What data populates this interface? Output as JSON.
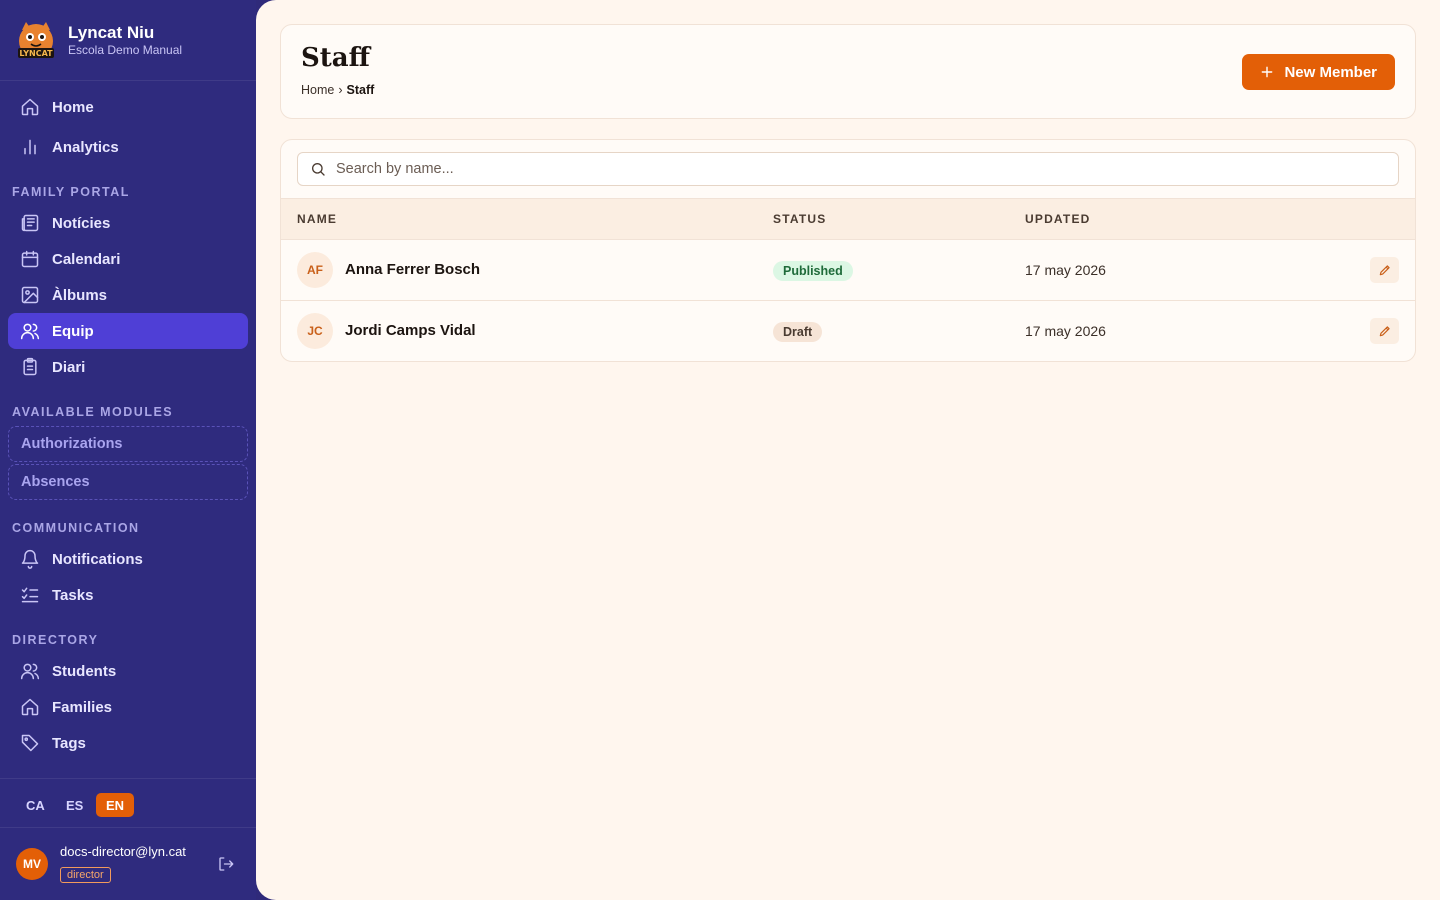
{
  "app": {
    "name": "Lyncat Niu",
    "subtitle": "Escola Demo Manual",
    "logo_text": "LYNCAT"
  },
  "sidebar": {
    "top_items": [
      {
        "label": "Home",
        "icon": "home-icon"
      },
      {
        "label": "Analytics",
        "icon": "bar-chart-icon"
      }
    ],
    "family_portal": {
      "heading": "FAMILY PORTAL",
      "items": [
        {
          "label": "Notícies",
          "icon": "newspaper-icon"
        },
        {
          "label": "Calendari",
          "icon": "calendar-icon"
        },
        {
          "label": "Àlbums",
          "icon": "image-icon"
        },
        {
          "label": "Equip",
          "icon": "users-icon",
          "active": true
        },
        {
          "label": "Diari",
          "icon": "clipboard-icon"
        }
      ]
    },
    "available_modules": {
      "heading": "AVAILABLE MODULES",
      "items": [
        {
          "label": "Authorizations"
        },
        {
          "label": "Absences"
        }
      ]
    },
    "communication": {
      "heading": "COMMUNICATION",
      "items": [
        {
          "label": "Notifications",
          "icon": "bell-icon"
        },
        {
          "label": "Tasks",
          "icon": "list-checks-icon"
        }
      ]
    },
    "directory": {
      "heading": "DIRECTORY",
      "items": [
        {
          "label": "Students",
          "icon": "users-icon"
        },
        {
          "label": "Families",
          "icon": "home-icon"
        },
        {
          "label": "Tags",
          "icon": "tag-icon"
        }
      ]
    },
    "languages": [
      "CA",
      "ES",
      "EN"
    ],
    "active_language": "EN",
    "user": {
      "initials": "MV",
      "email": "docs-director@lyn.cat",
      "role": "director"
    }
  },
  "header": {
    "title": "Staff",
    "breadcrumb": {
      "home": "Home",
      "separator": "›",
      "current": "Staff"
    },
    "new_button_label": "New Member"
  },
  "search": {
    "placeholder": "Search by name..."
  },
  "table": {
    "columns": [
      "NAME",
      "STATUS",
      "UPDATED"
    ],
    "rows": [
      {
        "initials": "AF",
        "name": "Anna Ferrer Bosch",
        "status": "Published",
        "updated": "17 may 2026"
      },
      {
        "initials": "JC",
        "name": "Jordi Camps Vidal",
        "status": "Draft",
        "updated": "17 may 2026"
      }
    ]
  },
  "colors": {
    "sidebar_bg": "#2f2b7e",
    "active_nav": "#4f3fd6",
    "accent": "#e35f07",
    "main_bg": "#fff6ee",
    "published_bg": "#dcf7e4",
    "draft_bg": "#f6e4d6"
  }
}
